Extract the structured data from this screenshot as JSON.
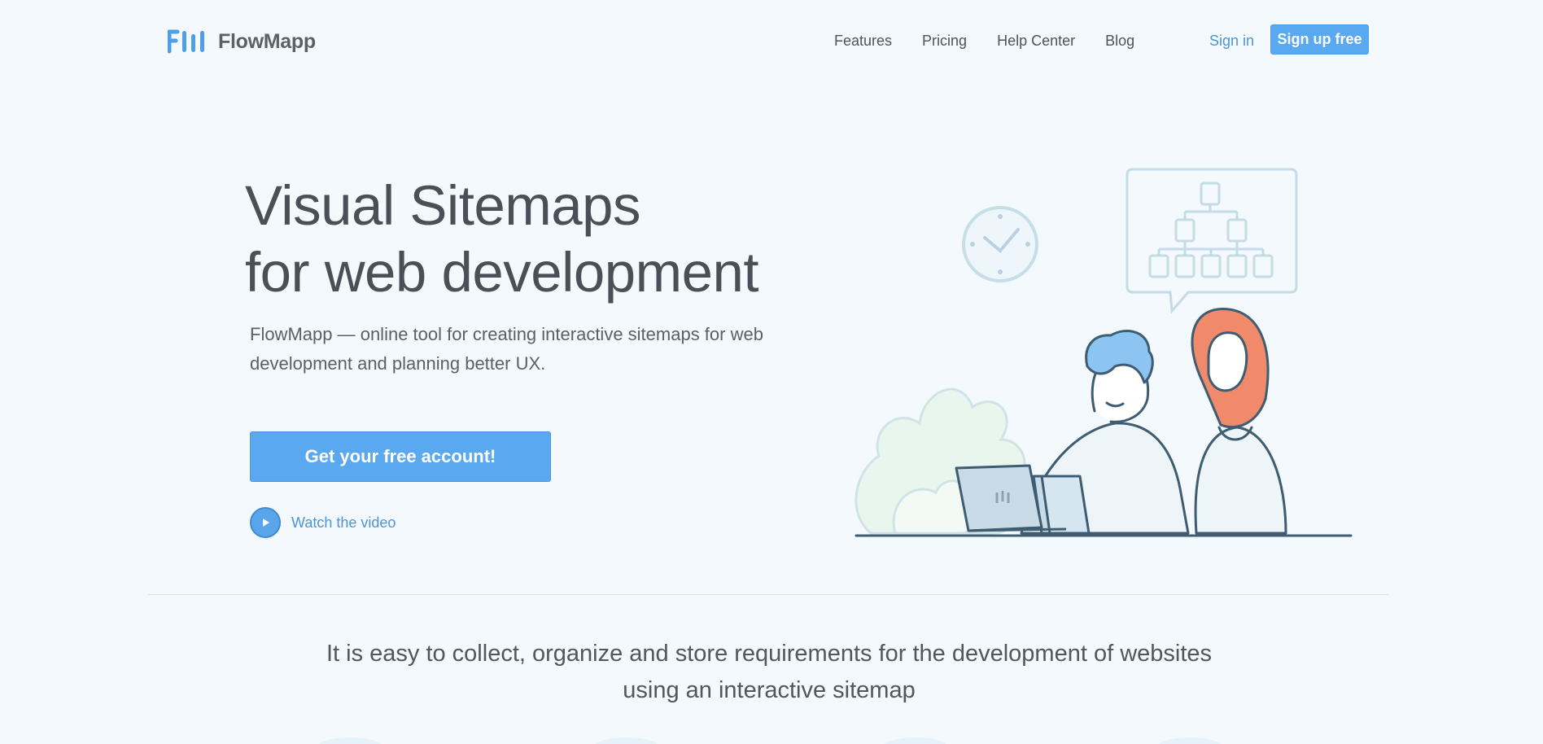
{
  "brand": {
    "name": "FlowMapp",
    "accent": "#5aa8f0",
    "link": "#4b95d8"
  },
  "nav": {
    "items": [
      {
        "label": "Features"
      },
      {
        "label": "Pricing"
      },
      {
        "label": "Help Center"
      },
      {
        "label": "Blog"
      }
    ],
    "signin_label": "Sign in",
    "signup_label": "Sign up free"
  },
  "hero": {
    "title_line1": "Visual Sitemaps",
    "title_line2": "for web development",
    "subtitle": "FlowMapp — online tool for creating interactive sitemaps for web development and planning better UX.",
    "cta_label": "Get your free account!",
    "video_label": "Watch the video",
    "icons": [
      "play-icon",
      "clock-icon",
      "sitemap-icon",
      "laptop-icon"
    ]
  },
  "section": {
    "tagline": "It is easy to collect, organize and store requirements for the development of websites using an interactive sitemap"
  }
}
